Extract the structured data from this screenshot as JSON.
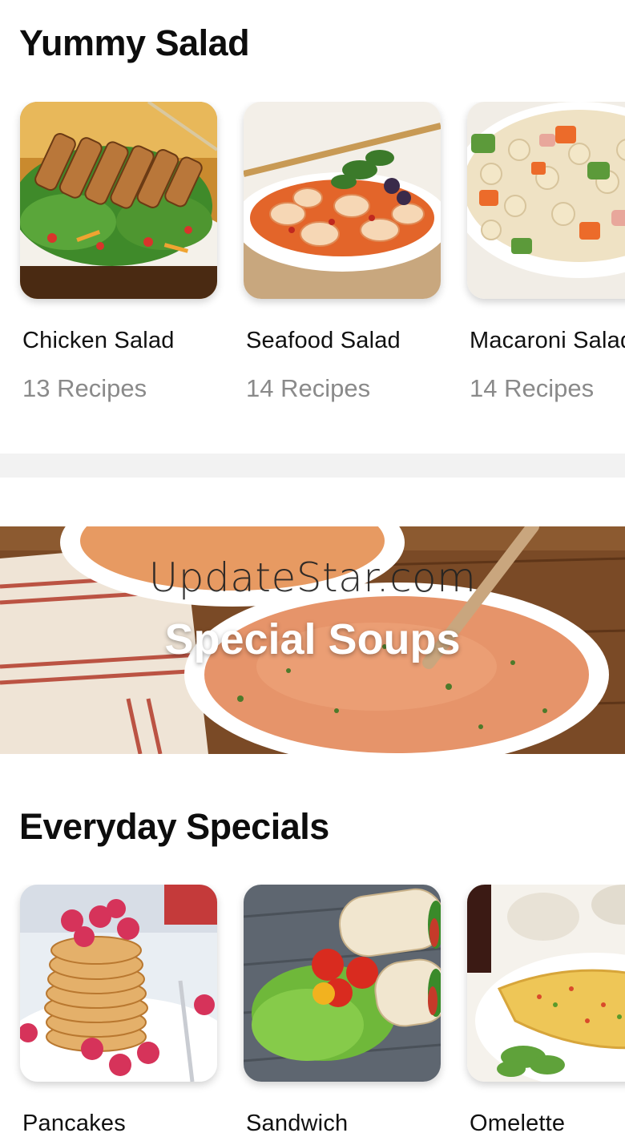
{
  "salad_section": {
    "title": "Yummy Salad",
    "items": [
      {
        "name": "Chicken Salad",
        "count": "13 Recipes"
      },
      {
        "name": "Seafood Salad",
        "count": "14 Recipes"
      },
      {
        "name": "Macaroni Salad",
        "count": "14 Recipes"
      }
    ]
  },
  "banner": {
    "title": "Special Soups",
    "watermark": "UpdateStar.com"
  },
  "everyday_section": {
    "title": "Everyday Specials",
    "items": [
      {
        "name": "Pancakes"
      },
      {
        "name": "Sandwich"
      },
      {
        "name": "Omelette"
      }
    ]
  },
  "colors": {
    "divider": "#f2f2f2",
    "count_text": "#8a8a8a",
    "title_text": "#0d0d0d"
  }
}
